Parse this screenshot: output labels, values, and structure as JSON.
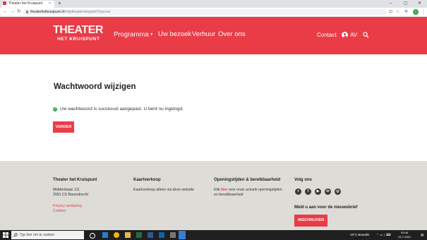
{
  "browser": {
    "tab_title": "Theater het Kruispunt",
    "tab_close": "×",
    "new_tab": "+",
    "url_domain": "theaterhetkruispunt.nl",
    "url_path": "/mijntheater/vergeten?succes",
    "back_glyph": "←",
    "forward_glyph": "→",
    "reload_glyph": "↻",
    "profile_initial": "T"
  },
  "header": {
    "logo_top": "THEATER",
    "logo_bottom": "HET KRUISPUNT",
    "nav": [
      {
        "label": "Programma",
        "has_dropdown": true
      },
      {
        "label": "Uw bezoek"
      },
      {
        "label": "Verhuur"
      },
      {
        "label": "Over ons"
      }
    ],
    "contact": "Contact",
    "user": "AV",
    "caret": "▾",
    "accent_color": "#ea3c47"
  },
  "main": {
    "title": "Wachtwoord wijzigen",
    "success_message": "Uw wachtwoord is succesvol aangepast. U bent nu ingelogd.",
    "success_icon": "check-icon",
    "button_label": "VERDER"
  },
  "footer": {
    "col1": {
      "heading": "Theater het Kruispunt",
      "address_line1": "Middenbaan 111",
      "address_line2": "2991 CS Barendrecht",
      "privacy_link": "Privacy verklaring",
      "cookies_link": "Cookies"
    },
    "col2": {
      "heading": "Kaartverkoop",
      "text": "Kaartverkoop alleen via deze website"
    },
    "col3": {
      "heading": "Openingstijden & bereikbaarheid",
      "text_before": "Klik ",
      "link": "hier",
      "text_after": " voor onze actuele openingstijden",
      "text_line2": "en bereikbaarheid"
    },
    "col4": {
      "heading": "Volg ons",
      "social": [
        {
          "name": "twitter-icon",
          "glyph": "t"
        },
        {
          "name": "facebook-icon",
          "glyph": "f"
        },
        {
          "name": "youtube-icon",
          "glyph": "▶"
        },
        {
          "name": "linkedin-icon",
          "glyph": "in"
        },
        {
          "name": "instagram-icon",
          "glyph": "◎"
        }
      ],
      "newsletter_heading": "Meld u aan voor de nieuwsbrief",
      "newsletter_button": "INSCHRIJVEN"
    }
  },
  "taskbar": {
    "search_placeholder": "Typ hier om te zoeken",
    "weather": "19°C  Bewolkt",
    "time": "09:45",
    "date": "23-7-2021"
  }
}
